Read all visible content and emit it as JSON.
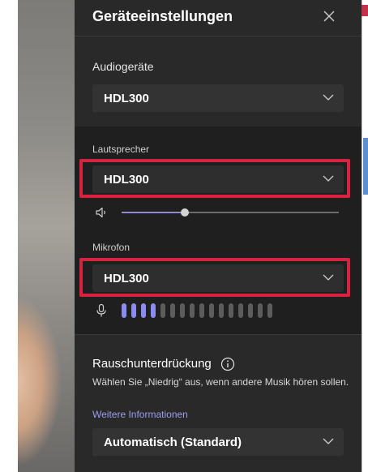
{
  "panel": {
    "title": "Geräteeinstellungen",
    "close_icon": "close-icon"
  },
  "audio_devices": {
    "label": "Audiogeräte",
    "value": "HDL300"
  },
  "speaker": {
    "label": "Lautsprecher",
    "value": "HDL300",
    "icon": "speaker-icon",
    "volume_fraction": 0.29
  },
  "microphone": {
    "label": "Mikrofon",
    "value": "HDL300",
    "icon": "microphone-icon",
    "level_bars_total": 16,
    "level_bars_active": 4
  },
  "noise_suppression": {
    "label": "Rauschunterdrückung",
    "description": "Wählen Sie „Niedrig“ aus, wenn andere Musik hören sollen.",
    "link": "Weitere Informationen",
    "value": "Automatisch (Standard)",
    "info_icon": "info-icon"
  },
  "colors": {
    "panel_bg": "#292929",
    "section_bg": "#1f1f1f",
    "highlight": "#d9223f",
    "accent": "#8b8cf0"
  }
}
